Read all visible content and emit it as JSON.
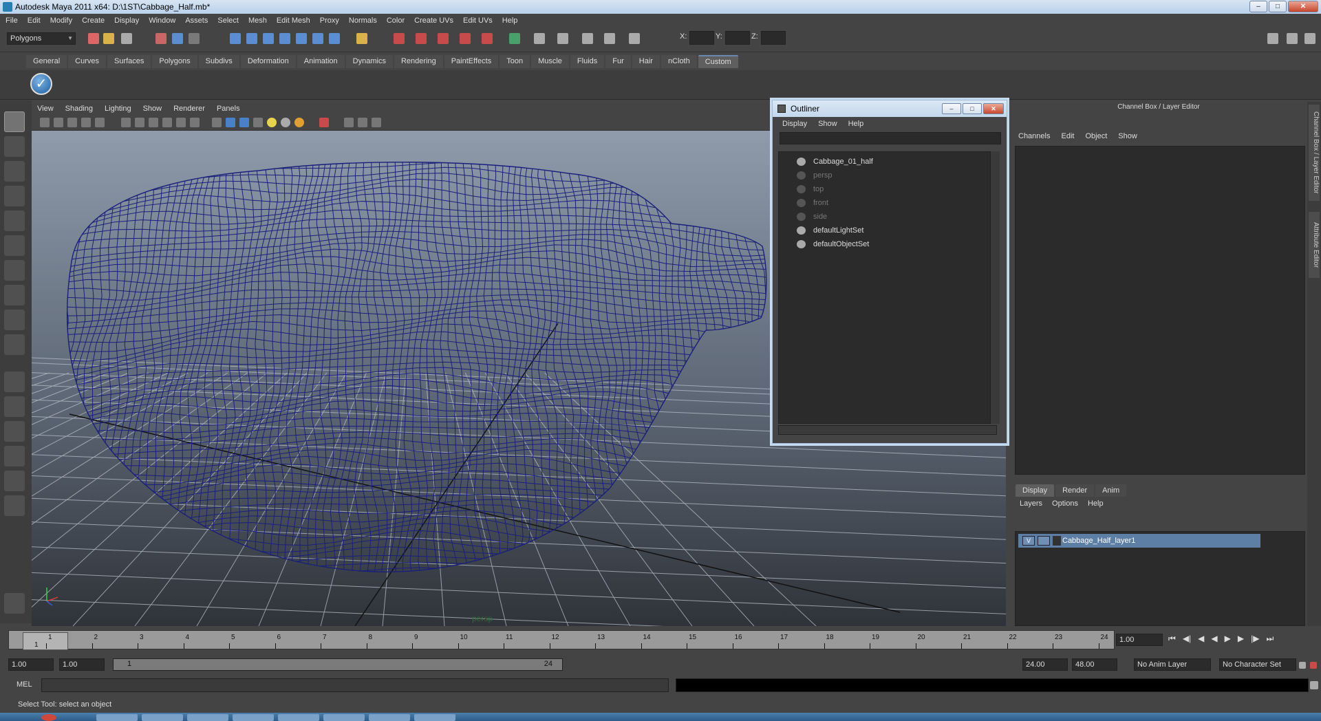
{
  "window": {
    "title": "Autodesk Maya 2011 x64: D:\\1ST\\Cabbage_Half.mb*"
  },
  "menubar": [
    "File",
    "Edit",
    "Modify",
    "Create",
    "Display",
    "Window",
    "Assets",
    "Select",
    "Mesh",
    "Edit Mesh",
    "Proxy",
    "Normals",
    "Color",
    "Create UVs",
    "Edit UVs",
    "Help"
  ],
  "status": {
    "mode": "Polygons",
    "x_label": "X:",
    "y_label": "Y:",
    "z_label": "Z:"
  },
  "shelf": {
    "tabs": [
      "General",
      "Curves",
      "Surfaces",
      "Polygons",
      "Subdivs",
      "Deformation",
      "Animation",
      "Dynamics",
      "Rendering",
      "PaintEffects",
      "Toon",
      "Muscle",
      "Fluids",
      "Fur",
      "Hair",
      "nCloth",
      "Custom"
    ],
    "active_tab": "Custom"
  },
  "viewport": {
    "menu": [
      "View",
      "Shading",
      "Lighting",
      "Show",
      "Renderer",
      "Panels"
    ],
    "camera_label": "persp",
    "wire_color": "#1a1f7a"
  },
  "outliner": {
    "title": "Outliner",
    "menu": [
      "Display",
      "Show",
      "Help"
    ],
    "items": [
      {
        "label": "Cabbage_01_half",
        "dim": false,
        "icon": "mesh-transform-icon"
      },
      {
        "label": "persp",
        "dim": true,
        "icon": "camera-icon"
      },
      {
        "label": "top",
        "dim": true,
        "icon": "camera-icon"
      },
      {
        "label": "front",
        "dim": true,
        "icon": "camera-icon"
      },
      {
        "label": "side",
        "dim": true,
        "icon": "camera-icon"
      },
      {
        "label": "defaultLightSet",
        "dim": false,
        "icon": "set-icon"
      },
      {
        "label": "defaultObjectSet",
        "dim": false,
        "icon": "set-icon"
      }
    ]
  },
  "channel_box": {
    "title": "Channel Box / Layer Editor",
    "menu": [
      "Channels",
      "Edit",
      "Object",
      "Show"
    ],
    "layer_tabs": [
      "Display",
      "Render",
      "Anim"
    ],
    "layer_menu": [
      "Layers",
      "Options",
      "Help"
    ],
    "layer": {
      "visible": "V",
      "name": "Cabbage_Half_layer1"
    },
    "side_tabs": [
      "Channel Box / Layer Editor",
      "Attribute Editor"
    ]
  },
  "timeline": {
    "ticks": [
      "1",
      "2",
      "3",
      "4",
      "5",
      "6",
      "7",
      "8",
      "9",
      "10",
      "11",
      "12",
      "13",
      "14",
      "15",
      "16",
      "17",
      "18",
      "19",
      "20",
      "21",
      "22",
      "23",
      "24"
    ],
    "current_frame": "1",
    "current_time_field": "1.00"
  },
  "range": {
    "start": "1.00",
    "playback_start": "1.00",
    "slider_start": "1",
    "slider_end": "24",
    "playback_end": "24.00",
    "end": "48.00",
    "anim_layer": "No Anim Layer",
    "char_set": "No Character Set"
  },
  "mel": {
    "label": "MEL"
  },
  "help_line": "Select Tool: select an object"
}
